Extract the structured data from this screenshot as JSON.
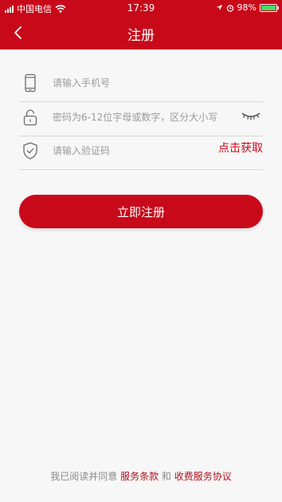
{
  "status_bar": {
    "carrier": "中国电信",
    "time": "17:39",
    "battery_percent": "98%",
    "battery_level": 0.98
  },
  "nav": {
    "title": "注册"
  },
  "form": {
    "phone_placeholder": "请输入手机号",
    "password_placeholder": "密码为6-12位字母或数字，区分大小写",
    "code_placeholder": "请输入验证码",
    "get_code_label": "点击获取"
  },
  "register_label": "立即注册",
  "agreement": {
    "prefix": "我已阅读并同意",
    "terms_link": "服务条款",
    "and": "和",
    "fee_link": "收费服务协议"
  },
  "colors": {
    "brand_red": "#c8091a",
    "battery_green": "#4cd964"
  },
  "icons": [
    "back-icon",
    "phone-icon",
    "lock-icon",
    "eye-closed-icon",
    "shield-check-icon",
    "wifi-icon",
    "location-icon",
    "alarm-icon"
  ]
}
